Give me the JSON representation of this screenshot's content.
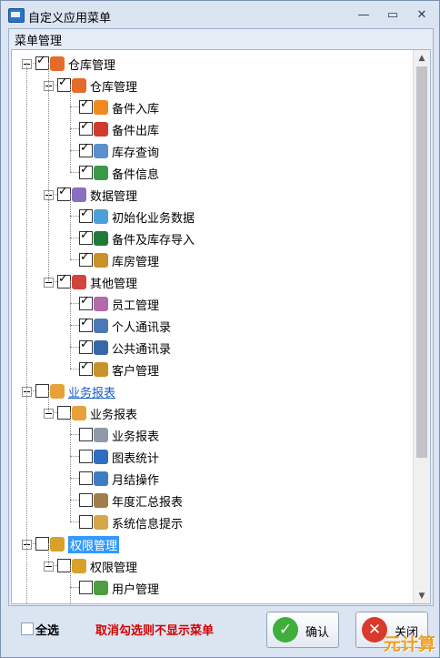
{
  "window": {
    "title": "自定义应用菜单",
    "controls": {
      "minimize": "—",
      "restore": "▭",
      "close": "✕"
    }
  },
  "group": {
    "title": "菜单管理"
  },
  "tree": [
    {
      "label": "仓库管理",
      "icon": "warehouse-icon",
      "checked": true,
      "level": 0,
      "expander": true
    },
    {
      "label": "仓库管理",
      "icon": "warehouse-icon",
      "checked": true,
      "level": 1,
      "expander": true
    },
    {
      "label": "备件入库",
      "icon": "plus-arrow-icon",
      "checked": true,
      "level": 2
    },
    {
      "label": "备件出库",
      "icon": "minus-bar-icon",
      "checked": true,
      "level": 2
    },
    {
      "label": "库存查询",
      "icon": "query-icon",
      "checked": true,
      "level": 2
    },
    {
      "label": "备件信息",
      "icon": "info-icon",
      "checked": true,
      "level": 2
    },
    {
      "label": "数据管理",
      "icon": "data-icon",
      "checked": true,
      "level": 1,
      "expander": true
    },
    {
      "label": "初始化业务数据",
      "icon": "init-icon",
      "checked": true,
      "level": 2
    },
    {
      "label": "备件及库存导入",
      "icon": "excel-icon",
      "checked": true,
      "level": 2
    },
    {
      "label": "库房管理",
      "icon": "people-icon",
      "checked": true,
      "level": 2
    },
    {
      "label": "其他管理",
      "icon": "other-icon",
      "checked": true,
      "level": 1,
      "expander": true
    },
    {
      "label": "员工管理",
      "icon": "employee-icon",
      "checked": true,
      "level": 2
    },
    {
      "label": "个人通讯录",
      "icon": "contacts-icon",
      "checked": true,
      "level": 2
    },
    {
      "label": "公共通讯录",
      "icon": "book-icon",
      "checked": true,
      "level": 2
    },
    {
      "label": "客户管理",
      "icon": "people-icon",
      "checked": true,
      "level": 2
    },
    {
      "label": "业务报表",
      "icon": "report-icon",
      "checked": false,
      "level": 0,
      "expander": true,
      "style": "link"
    },
    {
      "label": "业务报表",
      "icon": "report-icon",
      "checked": false,
      "level": 1,
      "expander": true
    },
    {
      "label": "业务报表",
      "icon": "doc-icon",
      "checked": false,
      "level": 2
    },
    {
      "label": "图表统计",
      "icon": "pie-chart-icon",
      "checked": false,
      "level": 2
    },
    {
      "label": "月结操作",
      "icon": "calendar-icon",
      "checked": false,
      "level": 2
    },
    {
      "label": "年度汇总报表",
      "icon": "summary-icon",
      "checked": false,
      "level": 2
    },
    {
      "label": "系统信息提示",
      "icon": "message-icon",
      "checked": false,
      "level": 2
    },
    {
      "label": "权限管理",
      "icon": "users-key-icon",
      "checked": false,
      "level": 0,
      "expander": true,
      "style": "selected"
    },
    {
      "label": "权限管理",
      "icon": "users-key-icon",
      "checked": false,
      "level": 1,
      "expander": true
    },
    {
      "label": "用户管理",
      "icon": "user-icon",
      "checked": false,
      "level": 2
    }
  ],
  "footer": {
    "select_all": "全选",
    "hint": "取消勾选则不显示菜单",
    "ok_button": "确认",
    "close_button": "关闭"
  },
  "watermark": "元计算"
}
